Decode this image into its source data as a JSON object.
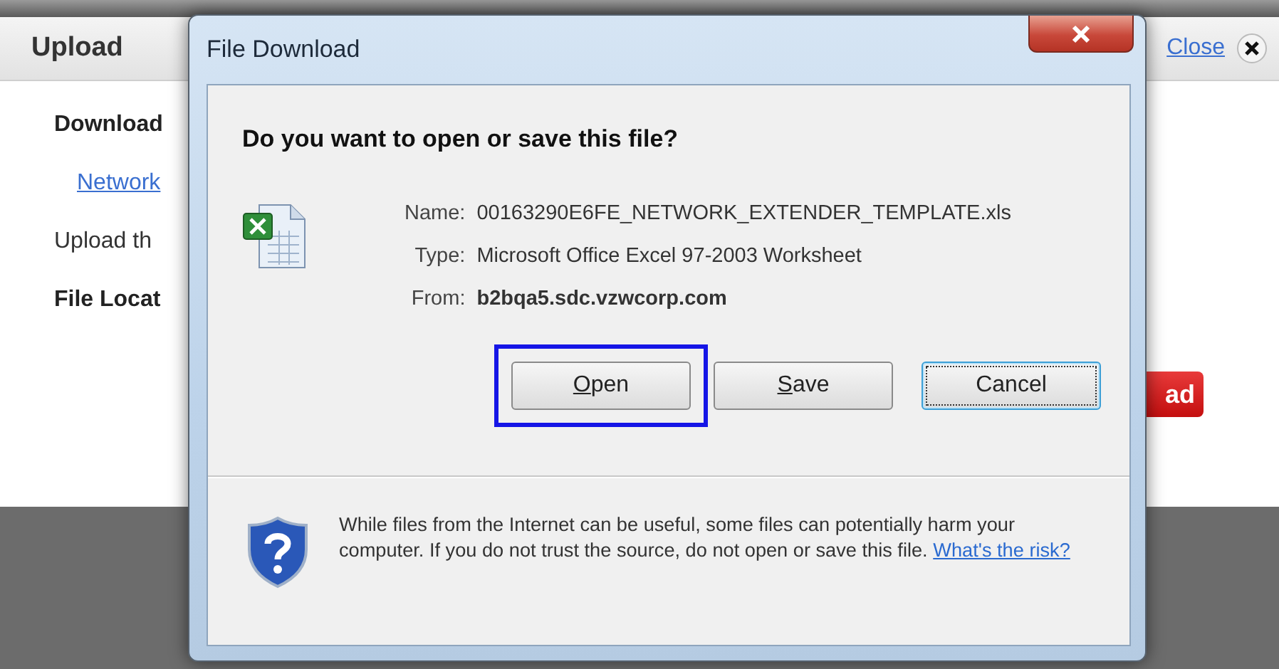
{
  "page": {
    "header": {
      "title": "Upload",
      "close_link": "Close"
    },
    "content": [
      {
        "kind": "heading",
        "text": "Download"
      },
      {
        "kind": "link",
        "text": "Network"
      },
      {
        "kind": "text",
        "text": "Upload th"
      },
      {
        "kind": "heading",
        "text": "File Locat"
      }
    ],
    "action_button": "ad"
  },
  "dialog": {
    "title": "File Download",
    "question": "Do you want to open or save this file?",
    "details": [
      {
        "label": "Name:",
        "value": "00163290E6FE_NETWORK_EXTENDER_TEMPLATE.xls",
        "bold": false
      },
      {
        "label": "Type:",
        "value": "Microsoft Office Excel 97-2003 Worksheet",
        "bold": false
      },
      {
        "label": "From:",
        "value": "b2bqa5.sdc.vzwcorp.com",
        "bold": true
      }
    ],
    "buttons": [
      {
        "label": "Open",
        "mnemonic": true,
        "highlighted": true,
        "focused": false
      },
      {
        "label": "Save",
        "mnemonic": true,
        "highlighted": false,
        "focused": false
      },
      {
        "label": "Cancel",
        "mnemonic": false,
        "highlighted": false,
        "focused": true
      }
    ],
    "warning": {
      "text": "While files from the Internet can be useful, some files can potentially harm your computer. If you do not trust the source, do not open or save this file.",
      "link": "What's the risk?"
    }
  }
}
